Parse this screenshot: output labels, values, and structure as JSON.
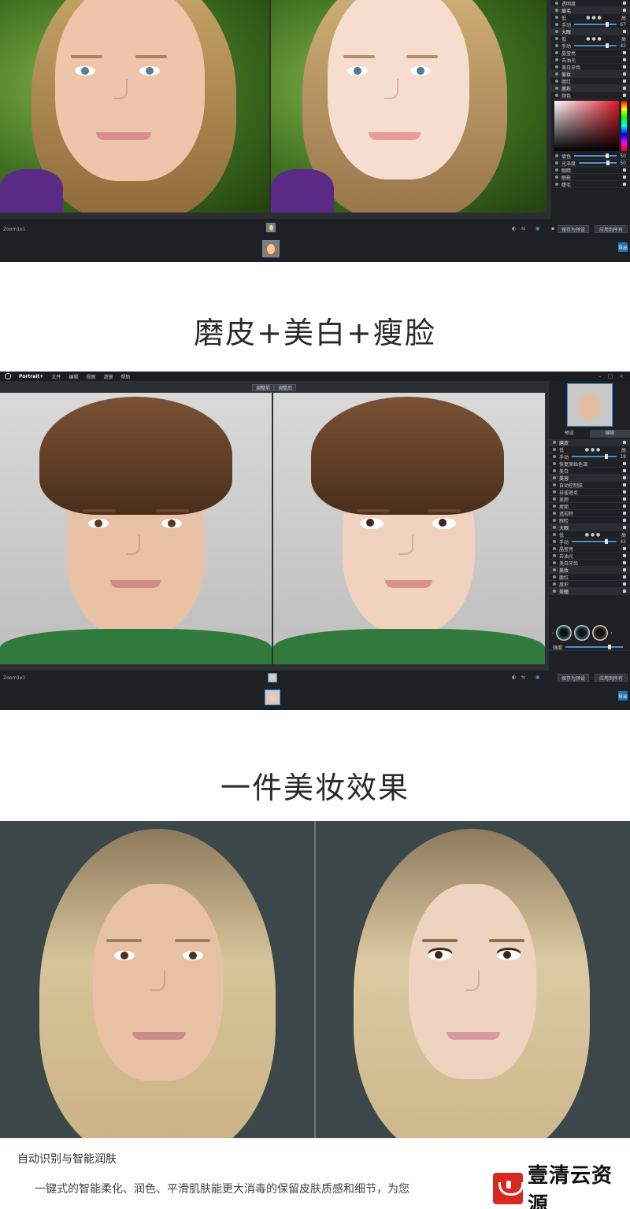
{
  "app1": {
    "zoom": "Zoom1x1",
    "panel_items": [
      {
        "label": "透明度",
        "type": "row"
      },
      {
        "label": "眉毛",
        "type": "section"
      },
      {
        "label": "低",
        "type": "dots",
        "right": "高"
      },
      {
        "label": "手动",
        "type": "slider",
        "value": "67"
      },
      {
        "label": "大眼",
        "type": "section"
      },
      {
        "label": "低",
        "type": "dots",
        "right": "高"
      },
      {
        "label": "手动",
        "type": "slider",
        "value": "42"
      },
      {
        "label": "晶莹亮",
        "type": "row"
      },
      {
        "label": "去油光",
        "type": "row"
      },
      {
        "label": "美白牙齿",
        "type": "row"
      },
      {
        "label": "美妆",
        "type": "section"
      },
      {
        "label": "腮红",
        "type": "row"
      },
      {
        "label": "唇彩",
        "type": "section"
      },
      {
        "label": "颜色",
        "type": "row"
      }
    ],
    "panel_items_bottom": [
      {
        "label": "填色",
        "type": "slider",
        "value": "50"
      },
      {
        "label": "光泽度",
        "type": "slider",
        "value": "50"
      },
      {
        "label": "眼睛",
        "type": "row"
      },
      {
        "label": "眼影",
        "type": "row"
      },
      {
        "label": "睫毛",
        "type": "row"
      }
    ],
    "save_label": "保存为预设",
    "apply_label": "应用到所有",
    "export_label": "导出"
  },
  "heading1": "磨皮+美白+瘦脸",
  "app2": {
    "app_name": "Portrait+",
    "menu": [
      "文件",
      "编辑",
      "视图",
      "滤镜",
      "帮助"
    ],
    "tab_before": "调整前",
    "tab_after": "调整后",
    "nav_tabs": [
      "预设",
      "编辑"
    ],
    "zoom": "Zoom1x1",
    "panel_items": [
      {
        "label": "磨皮",
        "type": "section"
      },
      {
        "label": "低",
        "type": "dots",
        "right": "高"
      },
      {
        "label": "手动",
        "type": "slider",
        "value": "18"
      },
      {
        "label": "恢复原始色调",
        "type": "row"
      },
      {
        "label": "美白",
        "type": "row"
      },
      {
        "label": "美容",
        "type": "section"
      },
      {
        "label": "自动控制肤",
        "type": "row"
      },
      {
        "label": "祛雀斑点",
        "type": "row"
      },
      {
        "label": "美颜",
        "type": "row"
      },
      {
        "label": "瘦面",
        "type": "row"
      },
      {
        "label": "透视特",
        "type": "row"
      },
      {
        "label": "眼睑",
        "type": "row"
      },
      {
        "label": "大眼",
        "type": "section"
      },
      {
        "label": "低",
        "type": "dots",
        "right": "高"
      },
      {
        "label": "手动",
        "type": "slider",
        "value": "42"
      },
      {
        "label": "晶莹亮",
        "type": "row"
      },
      {
        "label": "去油光",
        "type": "row"
      },
      {
        "label": "美白牙齿",
        "type": "row"
      },
      {
        "label": "美妆",
        "type": "section"
      },
      {
        "label": "腮红",
        "type": "row"
      },
      {
        "label": "唇彩",
        "type": "row"
      },
      {
        "label": "美瞳",
        "type": "section"
      }
    ],
    "intensity_label": "强度",
    "save_label": "保存为预设",
    "apply_label": "应用到所有",
    "export_label": "导出"
  },
  "heading2": "一件美妆效果",
  "caption": {
    "title": "自动识别与智能润肤",
    "body": "一键式的智能柔化、润色、平滑肌肤能更大消毒的保留皮肤质感和细节，为您"
  },
  "watermark": "壹清云资源",
  "colors": {
    "accent": "#4a90d9",
    "app_bg": "#2b2e33",
    "panel_bg": "#1e2024",
    "watermark_red": "#d9281f"
  }
}
